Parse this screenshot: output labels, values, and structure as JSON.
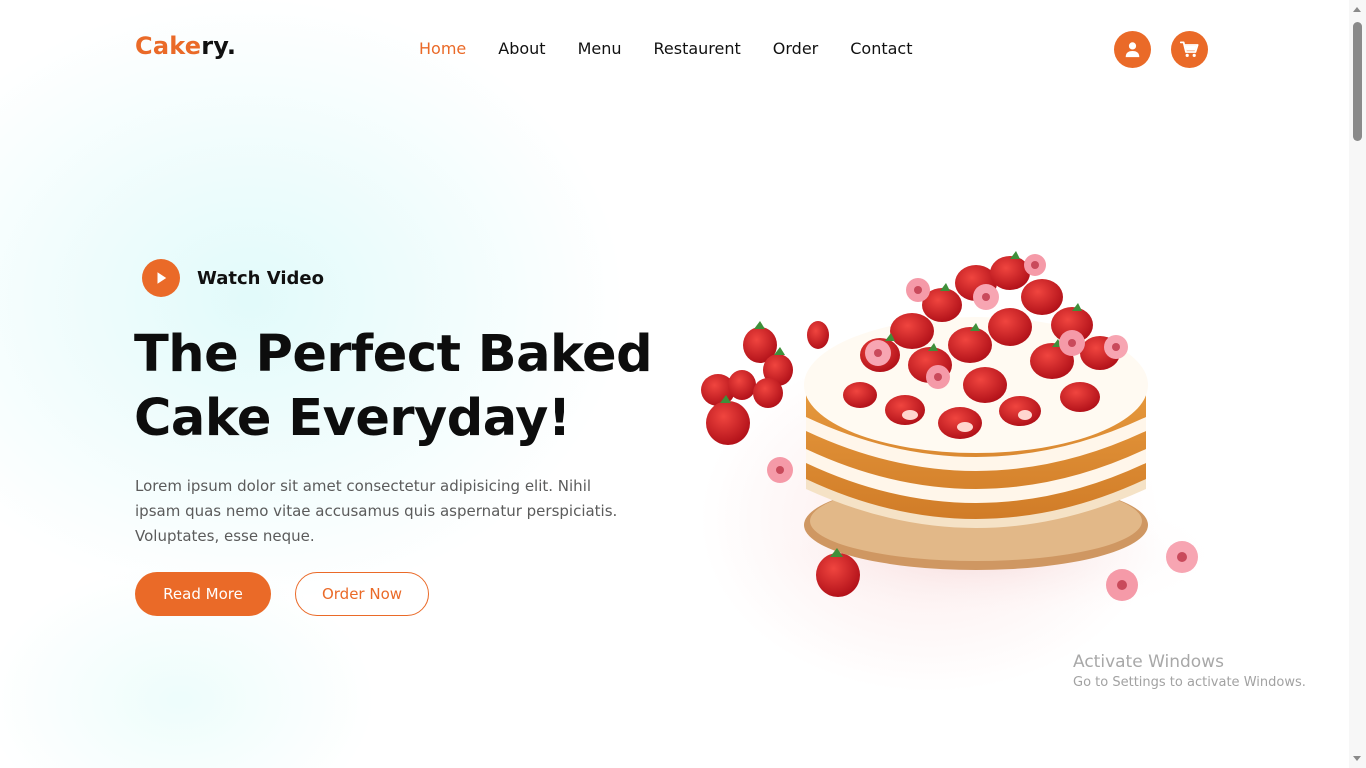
{
  "theme": {
    "accent": "#ea6a28",
    "text_dark": "#111111",
    "text_muted": "#5b5b5b"
  },
  "header": {
    "logo_accent": "Cake",
    "logo_rest": "ry."
  },
  "nav": [
    {
      "label": "Home",
      "active": true
    },
    {
      "label": "About",
      "active": false
    },
    {
      "label": "Menu",
      "active": false
    },
    {
      "label": "Restaurent",
      "active": false
    },
    {
      "label": "Order",
      "active": false
    },
    {
      "label": "Contact",
      "active": false
    }
  ],
  "header_icons": {
    "account": "user-icon",
    "cart": "cart-icon"
  },
  "hero": {
    "watch_label": "Watch Video",
    "watch_icon": "play-icon",
    "headline_line1": "The Perfect Baked",
    "headline_line2": "Cake Everyday!",
    "paragraph": "Lorem ipsum dolor sit amet consectetur adipisicing elit. Nihil ipsam quas nemo vitae accusamus quis aspernatur perspiciatis. Voluptates, esse neque.",
    "read_more": "Read More",
    "order_now": "Order Now",
    "image": "strawberry-layer-cake"
  },
  "watermark": {
    "title": "Activate Windows",
    "subtitle": "Go to Settings to activate Windows."
  }
}
